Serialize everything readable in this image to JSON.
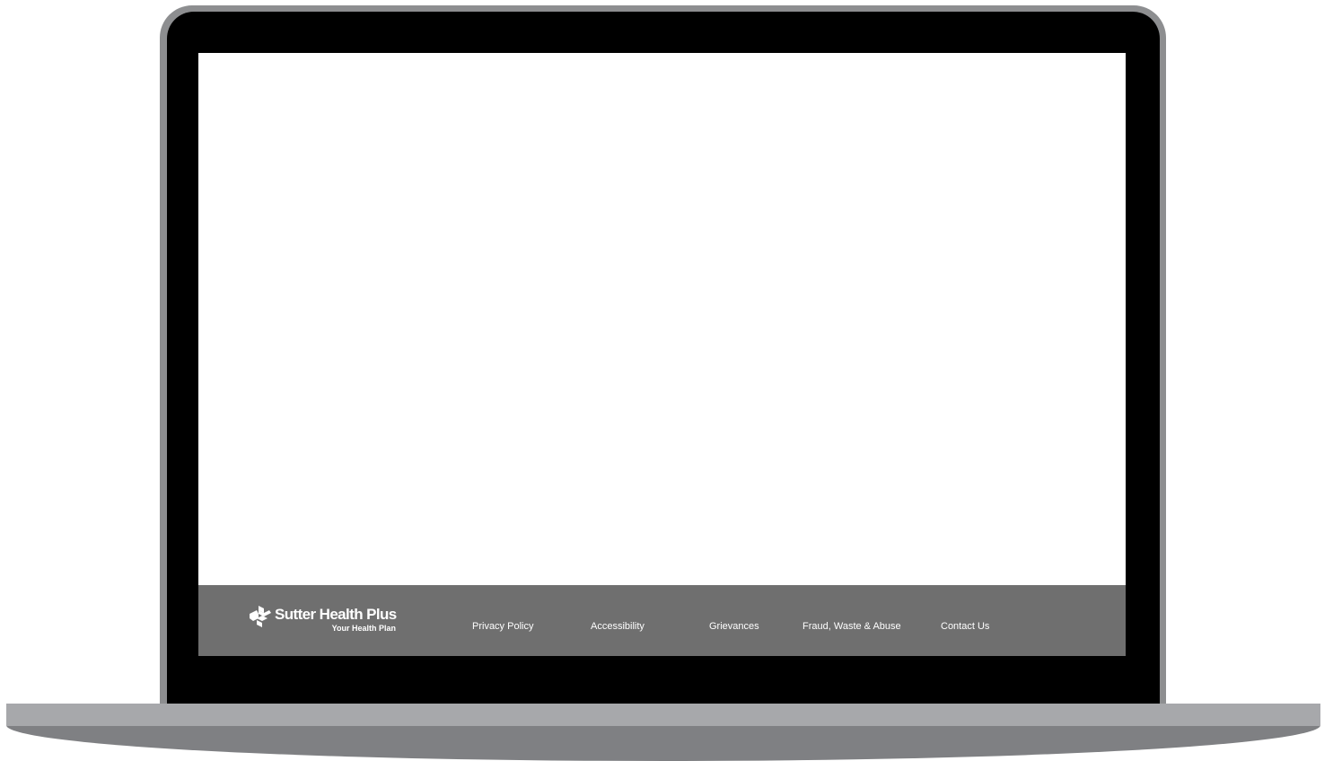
{
  "footer": {
    "logo": {
      "name": "Sutter Health Plus",
      "tagline": "Your Health Plan",
      "mark_icon": "sutter-cross-icon"
    },
    "links": [
      {
        "label": "Privacy Policy"
      },
      {
        "label": "Accessibility"
      },
      {
        "label": "Grievances"
      },
      {
        "label": "Fraud, Waste & Abuse"
      },
      {
        "label": "Contact Us"
      }
    ]
  },
  "colors": {
    "bezel": "#000000",
    "lid_edge": "#8d8e90",
    "footer_bg": "#6f6f6f",
    "footer_text": "#ffffff",
    "base_top": "#a7a8ab",
    "base_bottom": "#7f8083"
  }
}
